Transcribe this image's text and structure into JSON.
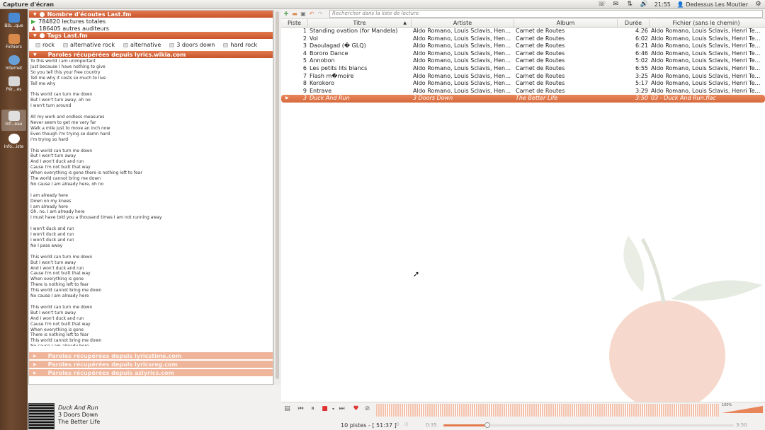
{
  "topbar": {
    "title": "Capture d'écran",
    "time": "21:55",
    "user": "Dedessus Les Moutier"
  },
  "sidebar": [
    {
      "label": "Bib...que",
      "color": "#4a8ad4"
    },
    {
      "label": "Fichiers",
      "color": "#d88a4a"
    },
    {
      "label": "Internet",
      "color": "#6aa0d8"
    },
    {
      "label": "Pér...es",
      "color": "#d8d8d8"
    },
    {
      "label": "Inf...eau",
      "color": "#e0e0e0"
    },
    {
      "label": "Info...iste",
      "color": "#ffffff"
    }
  ],
  "lastfm": {
    "listens_header": "Nombre d'écoutes Last.fm",
    "total_plays": "784820 lectures totales",
    "listeners": "186405 autres auditeurs",
    "tags_header": "Tags Last.fm",
    "tags": [
      "rock",
      "alternative rock",
      "alternative",
      "3 doors down",
      "hard rock"
    ]
  },
  "lyrics": {
    "header": "Paroles récupérées depuis lyrics.wikia.com",
    "text": "To this world I am unimportant\nJust because I have nothing to give\nSo you tell this your free country\nTell me why it costs so much to live\nTell me why\n\nThis world can turn me down\nBut I won't turn away, oh no\nI won't turn around\n\nAll my work and endless measures\nNever seem to get me very far\nWalk a mile just to move an inch now\nEven though I'm trying so damn hard\nI'm trying so hard\n\nThis world can turn me down\nBut I won't turn away\nAnd I won't duck and run\nCause I'm not built that way\nWhen everything is gone there is nothing left to fear\nThe world cannot bring me down\nNo cause I am already here, oh no\n\nI am already here\nDown on my knees\nI am already here\nOh, no, I am already here\nI must have told you a thousand times I am not running away\n\nI won't duck and run\nI won't duck and run\nI won't duck and run\nNo I pass away\n\nThis world can turn me down\nBut I won't turn away\nAnd I won't duck and run\nCause I'm not built that way\nWhen everything is gone\nThere is nothing left to fear\nThis world cannot bring me down\nNo cause I am already here\n\nThis world can turn me down\nBut I won't turn away\nAnd I won't duck and run\nCause I'm not built that way\nWhen everything is gone\nThere is nothing left to fear\nThis world cannot bring me down\nNo cause I am already here",
    "other_sources": [
      "Paroles récupérées depuis lyricstime.com",
      "Paroles récupérées depuis lyricsreg.com",
      "Paroles récupérées depuis azlyrics.com"
    ]
  },
  "now_playing": {
    "title": "Duck And Run",
    "artist": "3 Doors Down",
    "album": "The Better Life"
  },
  "playlist": {
    "search_placeholder": "Rechercher dans la liste de lecture",
    "columns": [
      "Piste",
      "Titre",
      "Artiste",
      "Album",
      "Durée",
      "Fichier (sans le chemin)"
    ],
    "rows": [
      {
        "track": "1",
        "title": "Standing ovation (for Mandela)",
        "artist": "Aldo Romano, Louis Sclavis, Henri T...",
        "album": "Carnet de Routes",
        "duration": "4:26",
        "file": "Aldo Romano, Louis Sclavis, Henri Texie..."
      },
      {
        "track": "2",
        "title": "Vol",
        "artist": "Aldo Romano, Louis Sclavis, Henri T...",
        "album": "Carnet de Routes",
        "duration": "6:02",
        "file": "Aldo Romano, Louis Sclavis, Henri Texie..."
      },
      {
        "track": "3",
        "title": "Daoulagad (� GLQ)",
        "artist": "Aldo Romano, Louis Sclavis, Henri T...",
        "album": "Carnet de Routes",
        "duration": "6:21",
        "file": "Aldo Romano, Louis Sclavis, Henri Texie..."
      },
      {
        "track": "4",
        "title": "Bororo Dance",
        "artist": "Aldo Romano, Louis Sclavis, Henri T...",
        "album": "Carnet de Routes",
        "duration": "6:46",
        "file": "Aldo Romano, Louis Sclavis, Henri Texie..."
      },
      {
        "track": "5",
        "title": "Annobon",
        "artist": "Aldo Romano, Louis Sclavis, Henri T...",
        "album": "Carnet de Routes",
        "duration": "5:02",
        "file": "Aldo Romano, Louis Sclavis, Henri Texie..."
      },
      {
        "track": "6",
        "title": "Les petits lits blancs",
        "artist": "Aldo Romano, Louis Sclavis, Henri T...",
        "album": "Carnet de Routes",
        "duration": "6:55",
        "file": "Aldo Romano, Louis Sclavis, Henri Texie..."
      },
      {
        "track": "7",
        "title": "Flash m�moire",
        "artist": "Aldo Romano, Louis Sclavis, Henri T...",
        "album": "Carnet de Routes",
        "duration": "3:25",
        "file": "Aldo Romano, Louis Sclavis, Henri Texie..."
      },
      {
        "track": "8",
        "title": "Korokoro",
        "artist": "Aldo Romano, Louis Sclavis, Henri T...",
        "album": "Carnet de Routes",
        "duration": "5:17",
        "file": "Aldo Romano, Louis Sclavis, Henri Texie..."
      },
      {
        "track": "9",
        "title": "Entrave",
        "artist": "Aldo Romano, Louis Sclavis, Henri T...",
        "album": "Carnet de Routes",
        "duration": "3:29",
        "file": "Aldo Romano, Louis Sclavis, Henri Texie..."
      },
      {
        "track": "3",
        "title": "Duck And Run",
        "artist": "3 Doors Down",
        "album": "The Better Life",
        "duration": "3:50",
        "file": "03 - Duck And Run.flac",
        "playing": true
      }
    ]
  },
  "status": {
    "summary": "10 pistes - [ 51:37 ]",
    "position": "0:35",
    "length": "3:50",
    "progress": 0.152,
    "volume_label": "100%"
  },
  "colors": {
    "accent": "#e27a4e",
    "sidebar": "#6e4a30"
  }
}
